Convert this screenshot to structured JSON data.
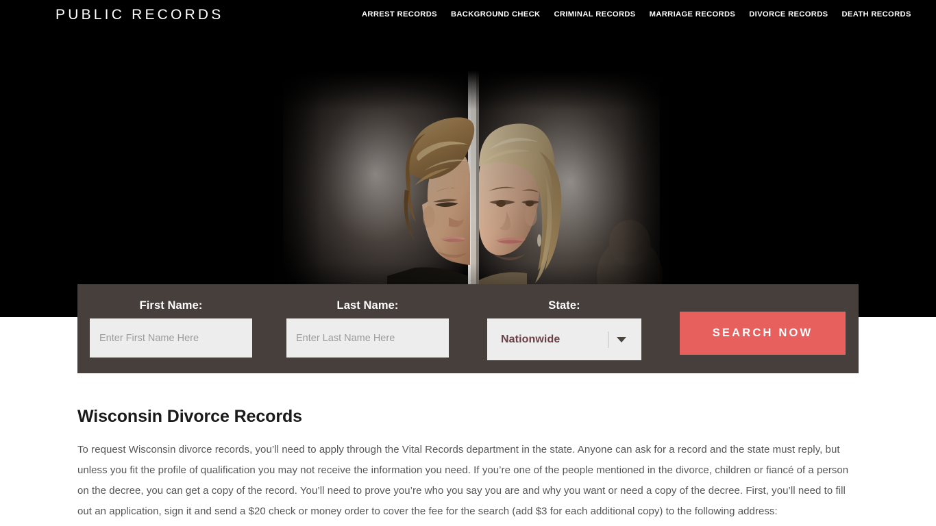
{
  "header": {
    "logo": "PUBLIC RECORDS",
    "nav": [
      {
        "label": "ARREST RECORDS"
      },
      {
        "label": "BACKGROUND CHECK"
      },
      {
        "label": "CRIMINAL RECORDS"
      },
      {
        "label": "MARRIAGE RECORDS"
      },
      {
        "label": "DIVORCE RECORDS"
      },
      {
        "label": "DEATH RECORDS"
      }
    ]
  },
  "hero": {
    "image_alt": "Couple separated by a wall, looking away from each other",
    "background_color": "#000000"
  },
  "search": {
    "bar_color": "#473F3C",
    "first_name": {
      "label": "First Name:",
      "placeholder": "Enter First Name Here",
      "value": ""
    },
    "last_name": {
      "label": "Last Name:",
      "placeholder": "Enter Last Name Here",
      "value": ""
    },
    "state": {
      "label": "State:",
      "selected": "Nationwide",
      "value_color": "#6B3F45"
    },
    "submit": {
      "label": "SEARCH NOW",
      "color": "#E8605E"
    }
  },
  "article": {
    "title": "Wisconsin Divorce Records",
    "paragraph": "To request Wisconsin divorce records, you’ll need to apply through the Vital Records department in the state. Anyone can ask for a record and the state must reply, but unless you fit the profile of qualification you may not receive the information you need. If you’re one of the people mentioned in the divorce, children or fiancé of a person on the decree, you can get a copy of the record. You’ll need to prove you’re who you say you are and why you want or need a copy of the decree. First, you’ll need to fill out an application, sign it and send a $20 check or money order to cover the fee for the search (add $3 for each additional copy) to the following address:"
  }
}
